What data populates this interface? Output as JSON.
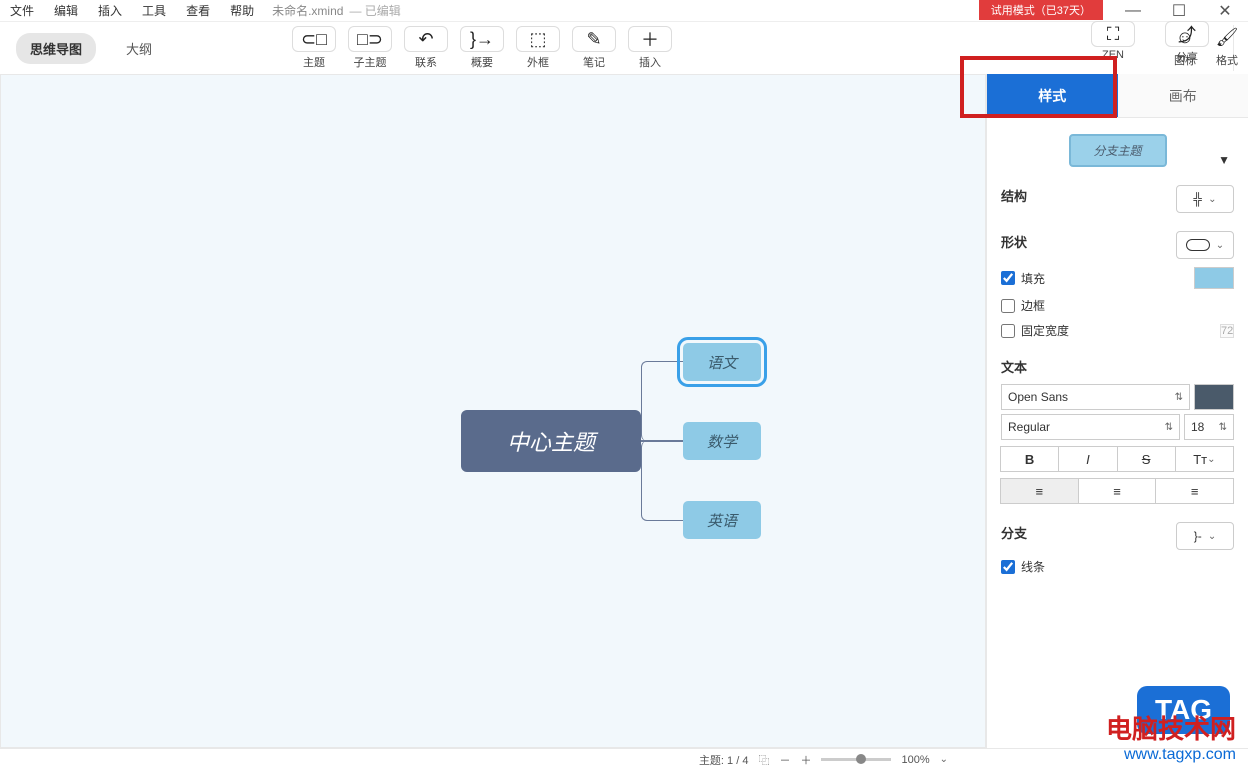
{
  "menu": {
    "file": "文件",
    "edit": "编辑",
    "insert": "插入",
    "tools": "工具",
    "view": "查看",
    "help": "帮助"
  },
  "document": {
    "name": "未命名.xmind",
    "status": "— 已编辑"
  },
  "trial": "试用模式（已37天）",
  "viewTabs": {
    "mindmap": "思维导图",
    "outline": "大纲"
  },
  "tools": {
    "topic": "主题",
    "subtopic": "子主题",
    "relation": "联系",
    "summary": "概要",
    "boundary": "外框",
    "note": "笔记",
    "insert": "插入",
    "zen": "ZEN",
    "share": "分享",
    "icons": "图标",
    "format": "格式"
  },
  "canvas": {
    "center": "中心主题",
    "sub1": "语文",
    "sub2": "数学",
    "sub3": "英语"
  },
  "side": {
    "tab_style": "样式",
    "tab_canvas": "画布",
    "preview": "分支主题",
    "structure": "结构",
    "shape": "形状",
    "fill": "填充",
    "border": "边框",
    "fixedWidth": "固定宽度",
    "widthValue": "72",
    "text": "文本",
    "font": "Open Sans",
    "weight": "Regular",
    "size": "18",
    "branch": "分支",
    "line": "线条"
  },
  "status": {
    "topics": "主题: 1 / 4",
    "zoom": "100%"
  },
  "watermark": {
    "line1": "电脑技术网",
    "line2": "www.tagxp.com",
    "tag": "TAG"
  }
}
